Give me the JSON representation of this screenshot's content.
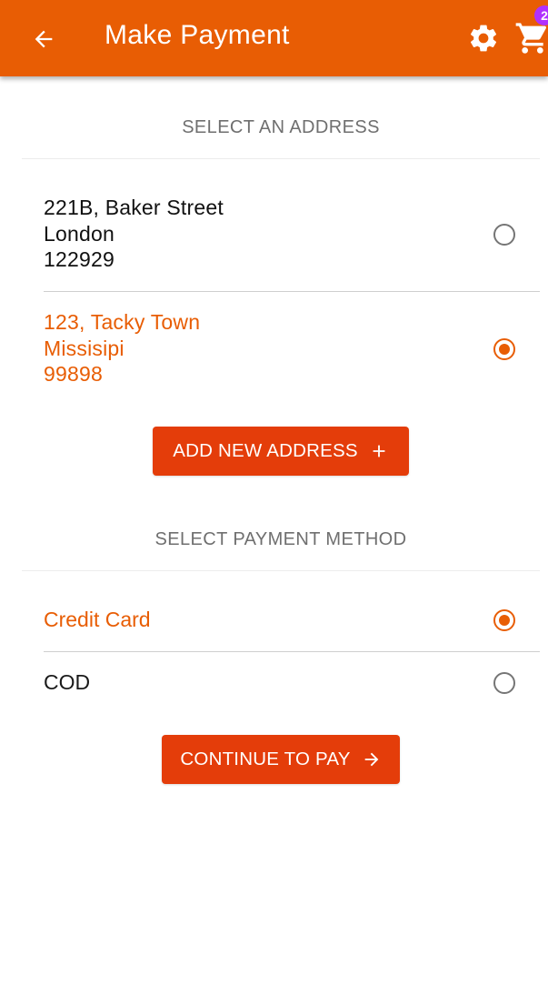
{
  "appbar": {
    "title": "Make Payment",
    "back_icon": "arrow-left-icon",
    "settings_icon": "gear-icon",
    "cart_icon": "shopping-cart-icon",
    "cart_count": "2",
    "background_color": "#e85d04",
    "badge_color": "#b030ff"
  },
  "address_section": {
    "header": "SELECT AN ADDRESS",
    "addresses": [
      {
        "line1": "221B, Baker Street",
        "line2": "London",
        "line3": "122929",
        "selected": false
      },
      {
        "line1": "123, Tacky Town",
        "line2": "Missisipi",
        "line3": "99898",
        "selected": true
      }
    ],
    "add_button_label": "ADD NEW ADDRESS",
    "add_button_icon": "plus-icon"
  },
  "payment_section": {
    "header": "SELECT PAYMENT METHOD",
    "methods": [
      {
        "label": "Credit Card",
        "selected": true
      },
      {
        "label": "COD",
        "selected": false
      }
    ],
    "continue_button_label": "CONTINUE TO PAY",
    "continue_button_icon": "arrow-right-icon"
  },
  "colors": {
    "accent": "#e85d04",
    "button": "#e43d0a",
    "muted_text": "#6f6f6f"
  }
}
